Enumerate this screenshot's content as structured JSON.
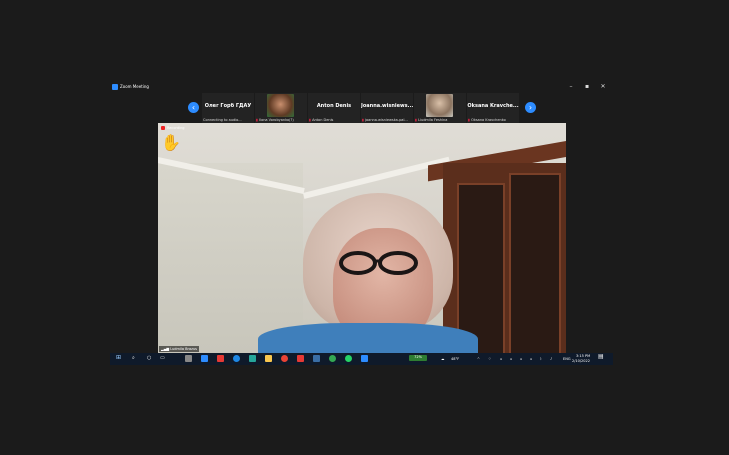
{
  "window": {
    "title": "Zoom Meeting",
    "minimize": "–",
    "maximize": "▪",
    "close": "✕"
  },
  "gallery": {
    "prev": "‹",
    "next": "›",
    "tiles": [
      {
        "name": "Олег Горб ГДАУ",
        "caption": "Connecting to audio..."
      },
      {
        "name": "",
        "caption": "Ilona Vorobyanko(?)"
      },
      {
        "name": "Anton Denis",
        "caption": "Anton Denis"
      },
      {
        "name": "Joanna.wisniews...",
        "caption": "joanna.wisniewska-pal..."
      },
      {
        "name": "",
        "caption": "Liudmila Feshina"
      },
      {
        "name": "Oksana Kravche...",
        "caption": "Oksana Kravchenko"
      }
    ]
  },
  "main_video": {
    "recording_label": "Recording",
    "hand": "✋",
    "speaker_name": "Ludmila Brazus"
  },
  "taskbar": {
    "battery": "72%",
    "weather": "48°F",
    "language": "ENG",
    "time": "3:15 PM",
    "date": "2/10/2022"
  },
  "colors": {
    "zoom_blue": "#2d8cff",
    "taskbar": "#0f1a2a",
    "sweater": "#3f7fbb"
  }
}
